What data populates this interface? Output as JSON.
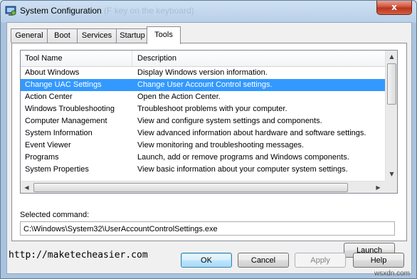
{
  "window": {
    "title": "System Configuration",
    "title_ghost": "(F key on the keyboard)",
    "close_label": "x"
  },
  "tabs": [
    {
      "label": "General"
    },
    {
      "label": "Boot"
    },
    {
      "label": "Services"
    },
    {
      "label": "Startup"
    },
    {
      "label": "Tools",
      "active": true
    }
  ],
  "tools_list": {
    "columns": [
      "Tool Name",
      "Description"
    ],
    "selected_index": 1,
    "rows": [
      {
        "name": "About Windows",
        "description": "Display Windows version information."
      },
      {
        "name": "Change UAC Settings",
        "description": "Change User Account Control settings."
      },
      {
        "name": "Action Center",
        "description": "Open the Action Center."
      },
      {
        "name": "Windows Troubleshooting",
        "description": "Troubleshoot problems with your computer."
      },
      {
        "name": "Computer Management",
        "description": "View and configure system settings and components."
      },
      {
        "name": "System Information",
        "description": "View advanced information about hardware and software settings."
      },
      {
        "name": "Event Viewer",
        "description": "View monitoring and troubleshooting messages."
      },
      {
        "name": "Programs",
        "description": "Launch, add or remove programs and Windows components."
      },
      {
        "name": "System Properties",
        "description": "View basic information about your computer system settings."
      }
    ]
  },
  "selected_command": {
    "label": "Selected command:",
    "value": "C:\\Windows\\System32\\UserAccountControlSettings.exe"
  },
  "buttons": {
    "launch": "Launch",
    "ok": "OK",
    "cancel": "Cancel",
    "apply": "Apply",
    "help": "Help"
  },
  "watermark": "http://maketecheasier.com",
  "watermark2": "wsxdn.com",
  "colors": {
    "selection": "#3399ff",
    "title_bar": "#b9d0e8",
    "close_button": "#cc4b32"
  }
}
